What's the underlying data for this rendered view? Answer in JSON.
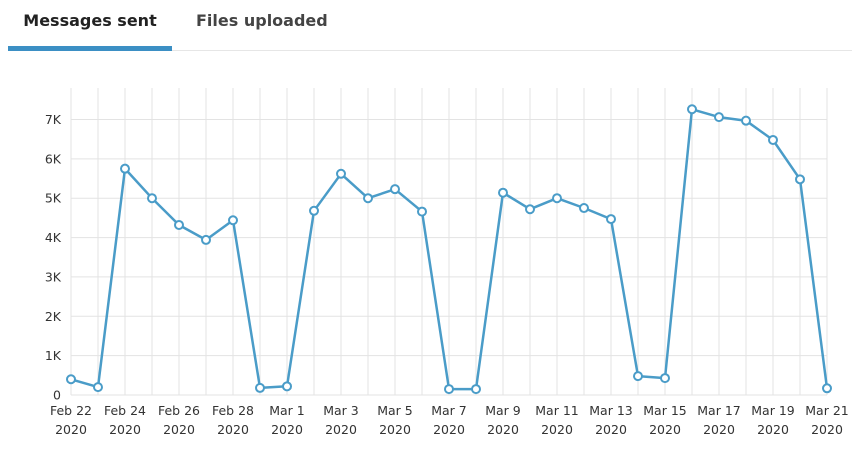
{
  "tabs": [
    {
      "label": "Messages sent",
      "active": true
    },
    {
      "label": "Files uploaded",
      "active": false
    }
  ],
  "colors": {
    "accent": "#3b8fc4",
    "line": "#4a9cc8",
    "grid": "#e3e3e3"
  },
  "chart_data": {
    "type": "line",
    "title": "",
    "xlabel": "",
    "ylabel": "",
    "ylim": [
      0,
      7800
    ],
    "grid": true,
    "y_ticks": [
      {
        "value": 0,
        "label": "0"
      },
      {
        "value": 1000,
        "label": "1K"
      },
      {
        "value": 2000,
        "label": "2K"
      },
      {
        "value": 3000,
        "label": "3K"
      },
      {
        "value": 4000,
        "label": "4K"
      },
      {
        "value": 5000,
        "label": "5K"
      },
      {
        "value": 6000,
        "label": "6K"
      },
      {
        "value": 7000,
        "label": "7K"
      }
    ],
    "x_tick_labels": [
      {
        "month_day": "Feb 22",
        "year": "2020"
      },
      {
        "month_day": "Feb 24",
        "year": "2020"
      },
      {
        "month_day": "Feb 26",
        "year": "2020"
      },
      {
        "month_day": "Feb 28",
        "year": "2020"
      },
      {
        "month_day": "Mar 1",
        "year": "2020"
      },
      {
        "month_day": "Mar 3",
        "year": "2020"
      },
      {
        "month_day": "Mar 5",
        "year": "2020"
      },
      {
        "month_day": "Mar 7",
        "year": "2020"
      },
      {
        "month_day": "Mar 9",
        "year": "2020"
      },
      {
        "month_day": "Mar 11",
        "year": "2020"
      },
      {
        "month_day": "Mar 13",
        "year": "2020"
      },
      {
        "month_day": "Mar 15",
        "year": "2020"
      },
      {
        "month_day": "Mar 17",
        "year": "2020"
      },
      {
        "month_day": "Mar 19",
        "year": "2020"
      },
      {
        "month_day": "Mar 21",
        "year": "2020"
      }
    ],
    "x": [
      "2020-02-22",
      "2020-02-23",
      "2020-02-24",
      "2020-02-25",
      "2020-02-26",
      "2020-02-27",
      "2020-02-28",
      "2020-02-29",
      "2020-03-01",
      "2020-03-02",
      "2020-03-03",
      "2020-03-04",
      "2020-03-05",
      "2020-03-06",
      "2020-03-07",
      "2020-03-08",
      "2020-03-09",
      "2020-03-10",
      "2020-03-11",
      "2020-03-12",
      "2020-03-13",
      "2020-03-14",
      "2020-03-15",
      "2020-03-16",
      "2020-03-17",
      "2020-03-18",
      "2020-03-19",
      "2020-03-20",
      "2020-03-21"
    ],
    "series": [
      {
        "values": [
          400,
          200,
          5750,
          5000,
          4320,
          3940,
          4440,
          180,
          220,
          4680,
          5620,
          5000,
          5230,
          4660,
          150,
          150,
          5140,
          4720,
          5000,
          4750,
          4470,
          480,
          430,
          7260,
          7060,
          6970,
          6480,
          5480,
          170
        ]
      }
    ]
  }
}
